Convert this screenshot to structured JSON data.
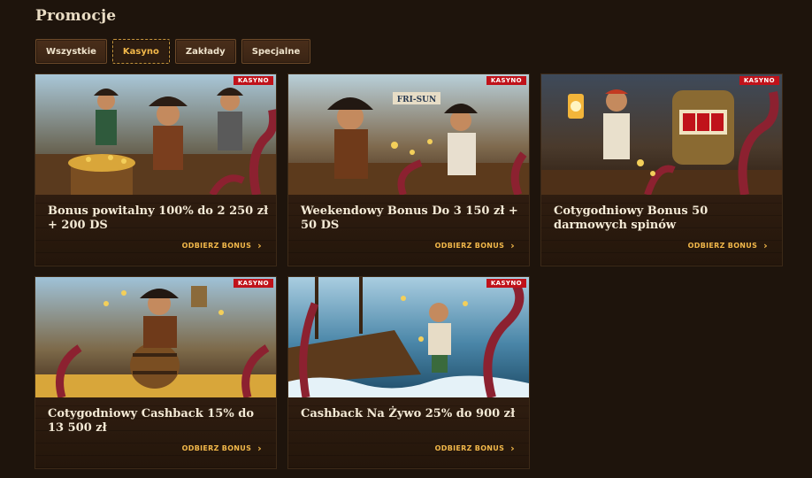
{
  "page": {
    "title": "Promocje"
  },
  "tabs": [
    {
      "label": "Wszystkie"
    },
    {
      "label": "Kasyno"
    },
    {
      "label": "Zakłady"
    },
    {
      "label": "Specjalne"
    }
  ],
  "active_tab": "Kasyno",
  "cards": [
    {
      "badge": "KASYNO",
      "title": "Bonus powitalny 100% do 2 250 zł + 200 DS",
      "cta": "ODBIERZ BONUS",
      "image": "pirates-with-treasure-and-octopus"
    },
    {
      "badge": "KASYNO",
      "title": "Weekendowy Bonus Do 3 150 zł + 50 DS",
      "cta": "ODBIERZ BONUS",
      "image": "pirate-couple-with-coins",
      "sign_text": "FRI-SUN"
    },
    {
      "badge": "KASYNO",
      "title": "Cotygodniowy Bonus 50 darmowych spinów",
      "cta": "ODBIERZ BONUS",
      "image": "pirate-with-lantern-and-slot-machine"
    },
    {
      "badge": "KASYNO",
      "title": "Cotygodniowy Cashback 15% do 13 500 zł",
      "cta": "ODBIERZ BONUS",
      "image": "pirate-on-barrel-with-tankard"
    },
    {
      "badge": "KASYNO",
      "title": "Cashback Na Żywo 25% do 900 zł",
      "cta": "ODBIERZ BONUS",
      "image": "pirates-ship-and-kraken"
    }
  ],
  "colors": {
    "background": "#1e140c",
    "accent": "#f2b84a",
    "badge": "#c0121a"
  }
}
